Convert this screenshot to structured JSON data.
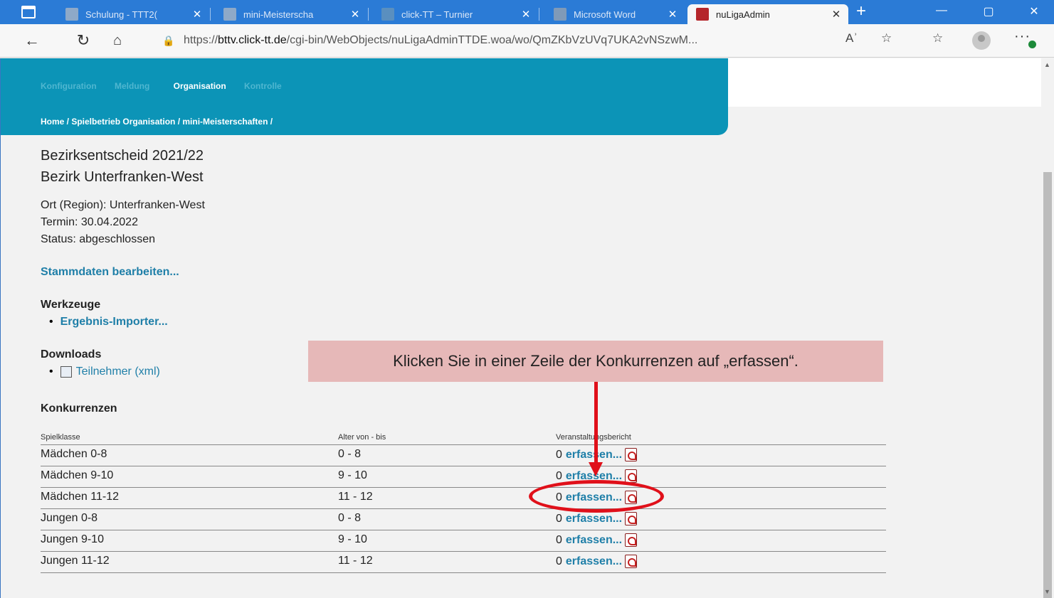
{
  "browser": {
    "tabs": [
      {
        "title": "Schulung - TTT2(",
        "active": false
      },
      {
        "title": "mini-Meisterscha",
        "active": false
      },
      {
        "title": "click-TT – Turnier",
        "active": false
      },
      {
        "title": "Microsoft Word",
        "active": false
      },
      {
        "title": "nuLigaAdmin",
        "active": true
      }
    ],
    "url_domain": "bttv.click-tt.de",
    "url_prefix": "https://",
    "url_rest": "/cgi-bin/WebObjects/nuLigaAdminTTDE.woa/wo/QmZKbVzUVq7UKA2vNSzwM...",
    "read_aloud_label": "Aʾ"
  },
  "header": {
    "nav": [
      "Konfiguration",
      "Meldung",
      "Organisation",
      "Kontrolle"
    ],
    "breadcrumb": "Home / Spielbetrieb Organisation / mini-Meisterschaften /"
  },
  "event": {
    "title": "Bezirksentscheid 2021/22",
    "subtitle": "Bezirk Unterfranken-West",
    "ort": "Ort (Region): Unterfranken-West",
    "termin": "Termin: 30.04.2022",
    "status": "Status: abgeschlossen",
    "edit_link": "Stammdaten bearbeiten..."
  },
  "tools": {
    "heading": "Werkzeuge",
    "item": "Ergebnis-Importer..."
  },
  "downloads": {
    "heading": "Downloads",
    "item": "Teilnehmer (xml)"
  },
  "competitions": {
    "heading": "Konkurrenzen",
    "columns": [
      "Spielklasse",
      "Alter von - bis",
      "Veranstaltungsbericht"
    ],
    "rows": [
      {
        "klasse": "Mädchen 0-8",
        "alter": "0 - 8",
        "count": "0",
        "action": "erfassen..."
      },
      {
        "klasse": "Mädchen 9-10",
        "alter": "9 - 10",
        "count": "0",
        "action": "erfassen..."
      },
      {
        "klasse": "Mädchen 11-12",
        "alter": "11 - 12",
        "count": "0",
        "action": "erfassen..."
      },
      {
        "klasse": "Jungen 0-8",
        "alter": "0 - 8",
        "count": "0",
        "action": "erfassen..."
      },
      {
        "klasse": "Jungen 9-10",
        "alter": "9 - 10",
        "count": "0",
        "action": "erfassen..."
      },
      {
        "klasse": "Jungen 11-12",
        "alter": "11 - 12",
        "count": "0",
        "action": "erfassen..."
      }
    ]
  },
  "annotation": {
    "text": "Klicken Sie in einer Zeile der Konkurrenzen auf „erfassen“.",
    "color": "#e0101a",
    "box_color": "#e6b8b8"
  },
  "colors": {
    "header_band": "#0c94b7",
    "tab_bar": "#2b7bd6",
    "link": "#1f7fa8"
  }
}
